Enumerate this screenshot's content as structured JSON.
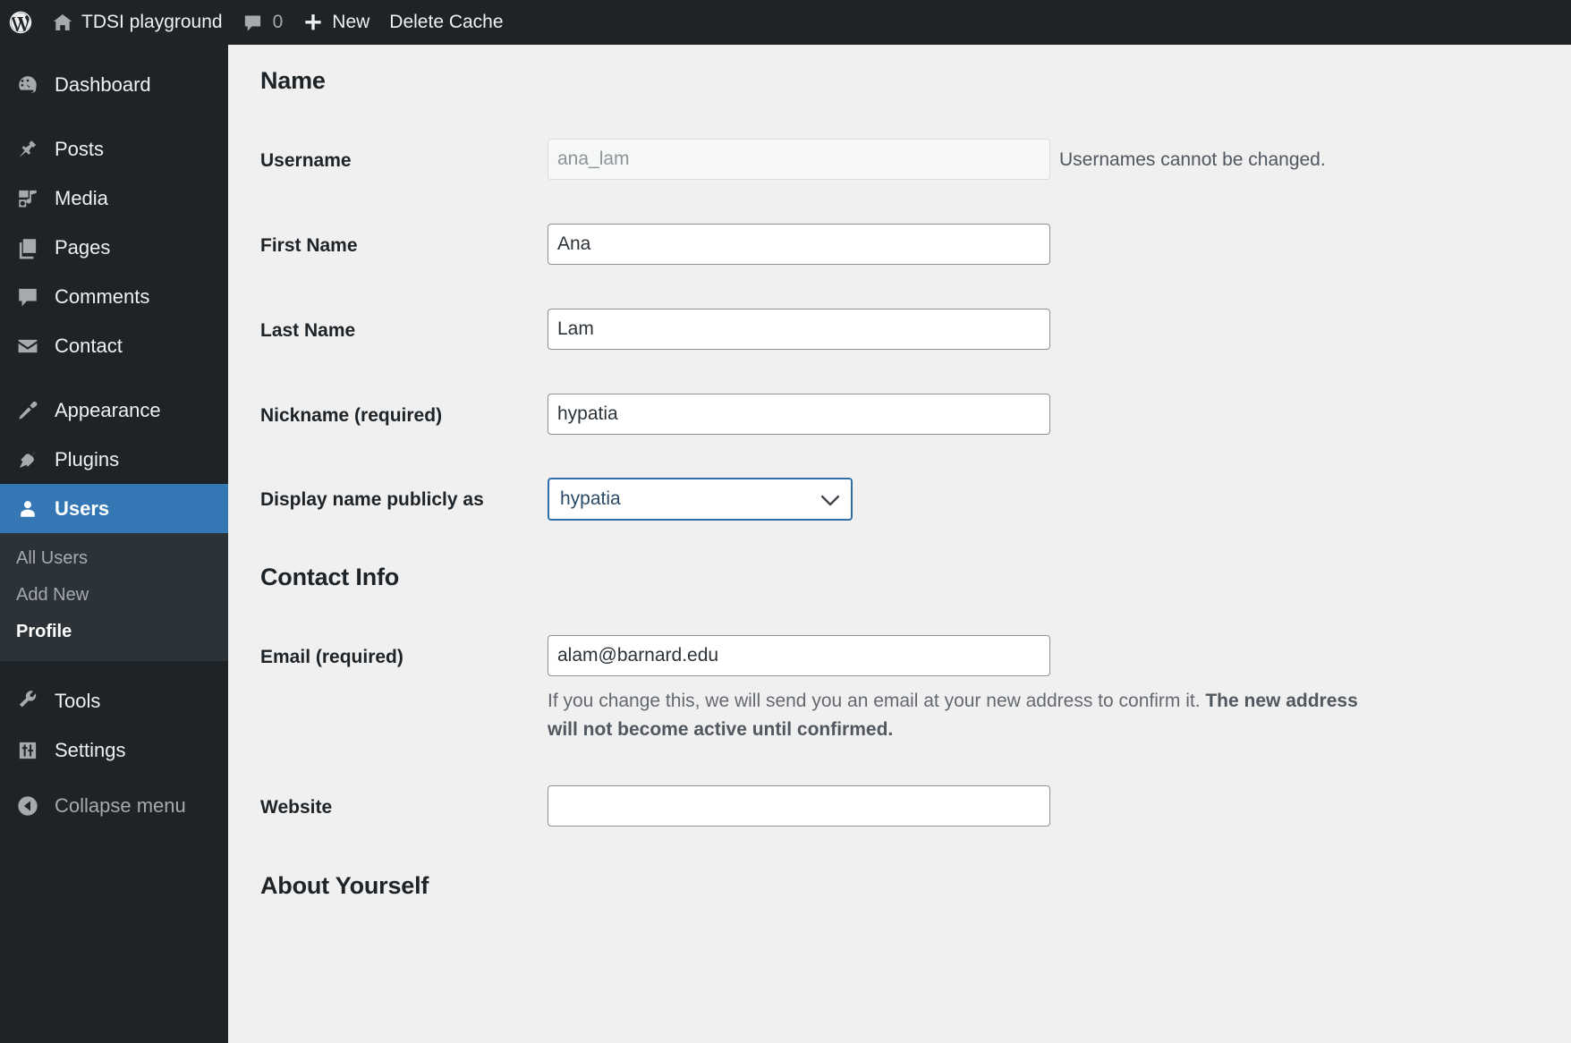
{
  "adminbar": {
    "wp_logo": "wordpress-logo-icon",
    "site_name": "TDSI playground",
    "comments_count": "0",
    "new_label": "New",
    "delete_cache_label": "Delete Cache"
  },
  "sidebar": {
    "items": [
      {
        "label": "Dashboard",
        "icon": "dashboard-icon",
        "current": false
      },
      {
        "label": "Posts",
        "icon": "pin-icon",
        "current": false
      },
      {
        "label": "Media",
        "icon": "media-icon",
        "current": false
      },
      {
        "label": "Pages",
        "icon": "pages-icon",
        "current": false
      },
      {
        "label": "Comments",
        "icon": "comment-icon",
        "current": false
      },
      {
        "label": "Contact",
        "icon": "envelope-icon",
        "current": false
      },
      {
        "label": "Appearance",
        "icon": "paintbrush-icon",
        "current": false
      },
      {
        "label": "Plugins",
        "icon": "plug-icon",
        "current": false
      },
      {
        "label": "Users",
        "icon": "user-icon",
        "current": true
      },
      {
        "label": "Tools",
        "icon": "wrench-icon",
        "current": false
      },
      {
        "label": "Settings",
        "icon": "sliders-icon",
        "current": false
      }
    ],
    "submenu": [
      {
        "label": "All Users",
        "current": false
      },
      {
        "label": "Add New",
        "current": false
      },
      {
        "label": "Profile",
        "current": true
      }
    ],
    "collapse_label": "Collapse menu",
    "accent_color": "#3577b5",
    "background_color": "#1d2327",
    "submenu_background": "#2c3338"
  },
  "main": {
    "sections": {
      "name": "Name",
      "contact_info": "Contact Info",
      "about_yourself": "About Yourself"
    },
    "fields": {
      "username": {
        "label": "Username",
        "value": "ana_lam",
        "help": "Usernames cannot be changed."
      },
      "first_name": {
        "label": "First Name",
        "value": "Ana"
      },
      "last_name": {
        "label": "Last Name",
        "value": "Lam"
      },
      "nickname": {
        "label": "Nickname (required)",
        "value": "hypatia"
      },
      "display_name": {
        "label": "Display name publicly as",
        "value": "hypatia",
        "caret_icon": "chevron-down-icon",
        "focus_color": "#2f6fa8"
      },
      "email": {
        "label": "Email (required)",
        "value": "alam@barnard.edu",
        "desc_normal": "If you change this, we will send you an email at your new address to confirm it. ",
        "desc_bold": "The new address will not become active until confirmed."
      },
      "website": {
        "label": "Website",
        "value": ""
      }
    }
  }
}
